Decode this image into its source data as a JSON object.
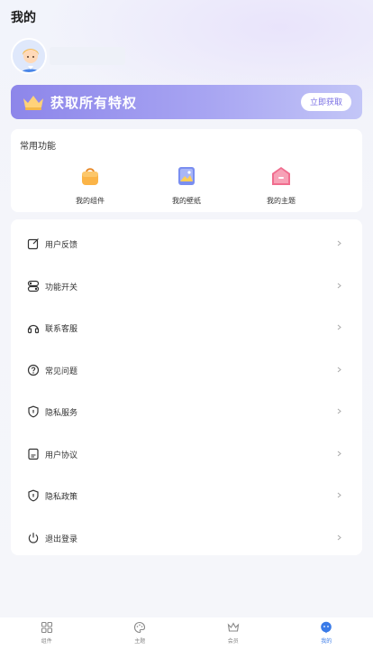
{
  "header": {
    "title": "我的"
  },
  "banner": {
    "text": "获取所有特权",
    "button": "立即获取"
  },
  "common": {
    "title": "常用功能",
    "items": [
      {
        "label": "我的组件",
        "icon": "bag-icon"
      },
      {
        "label": "我的壁纸",
        "icon": "wallpaper-icon"
      },
      {
        "label": "我的主题",
        "icon": "theme-icon"
      }
    ]
  },
  "menu": [
    {
      "label": "用户反馈",
      "icon": "edit-icon"
    },
    {
      "label": "功能开关",
      "icon": "toggle-icon"
    },
    {
      "label": "联系客服",
      "icon": "headphone-icon"
    },
    {
      "label": "常见问题",
      "icon": "question-icon"
    },
    {
      "label": "隐私服务",
      "icon": "shield-icon"
    },
    {
      "label": "用户协议",
      "icon": "document-icon"
    },
    {
      "label": "隐私政策",
      "icon": "shield-icon"
    },
    {
      "label": "退出登录",
      "icon": "power-icon"
    }
  ],
  "tabs": [
    {
      "label": "组件",
      "icon": "widget-icon",
      "active": false
    },
    {
      "label": "主题",
      "icon": "palette-icon",
      "active": false
    },
    {
      "label": "会员",
      "icon": "crown-icon",
      "active": false
    },
    {
      "label": "我的",
      "icon": "profile-icon",
      "active": true
    }
  ],
  "colors": {
    "accent": "#3a7be8",
    "banner_start": "#8d86ea",
    "banner_end": "#c3c6f7"
  }
}
